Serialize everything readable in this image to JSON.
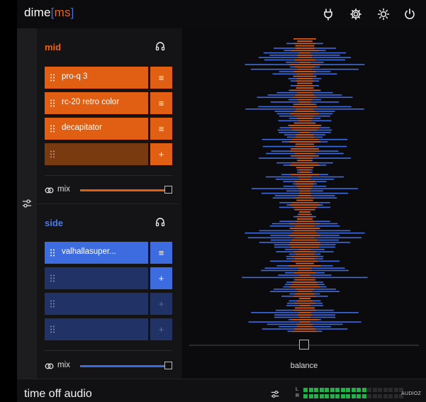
{
  "app": {
    "logo_main": "dime",
    "logo_open": "[",
    "logo_ms": "ms",
    "logo_close": "]",
    "brand": "time off audio",
    "watermark": "AUDIOZ"
  },
  "header_icons": [
    "plug-icon",
    "settings-gear-icon",
    "brightness-icon",
    "power-icon"
  ],
  "mid": {
    "title": "mid",
    "slots": [
      {
        "label": "pro-q 3",
        "button": "≡"
      },
      {
        "label": "rc-20 retro color",
        "button": "≡"
      },
      {
        "label": "decapitator",
        "button": "≡"
      },
      {
        "label": "",
        "button": "+"
      }
    ],
    "mix_label": "mix",
    "mix_value": 1.0
  },
  "side": {
    "title": "side",
    "slots": [
      {
        "label": "valhallasuper...",
        "button": "≡"
      },
      {
        "label": "",
        "button": "+"
      },
      {
        "label": "",
        "button": "+"
      },
      {
        "label": "",
        "button": "+"
      }
    ],
    "mix_label": "mix",
    "mix_value": 1.0
  },
  "balance": {
    "label": "balance",
    "value": 0.5
  },
  "meters": {
    "left_label": "L",
    "right_label": "R",
    "segments_total": 19,
    "left_lit": 12,
    "right_lit": 12
  },
  "colors": {
    "mid_accent": "#e05f12",
    "side_accent": "#3d6be0",
    "meter_green": "#22b04a"
  }
}
